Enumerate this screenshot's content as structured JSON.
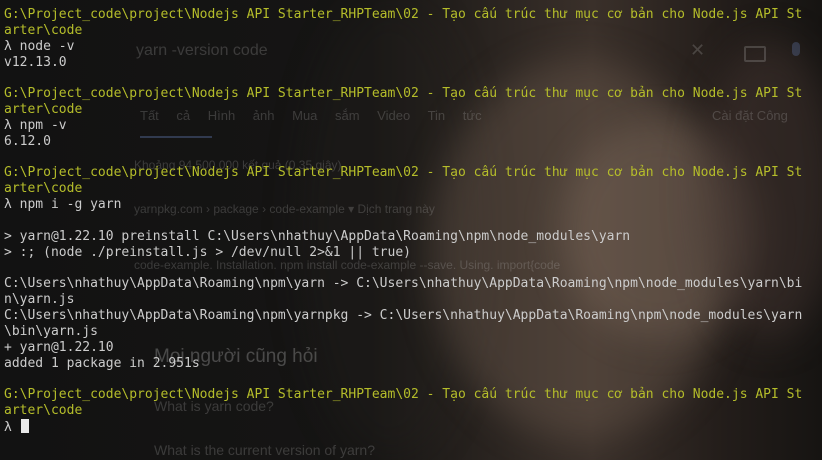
{
  "background_page": {
    "search_query": "yarn -version code",
    "tabs": "Tất cả  Hình ảnh  Mua sắm  Video  Tin tức",
    "tabs_right": "Cài đặt   Công",
    "result_count": "Khoảng 94.500.000 kết quả (0,35 giây)",
    "site_line": "yarnpkg.com › package › code-example ▾ Dịch trang này",
    "snippet": "code-example. Installation. npm install code-example --save. Using. import{code",
    "people_also_ask": "Mọi người cũng hỏi",
    "question_1": "What is yarn code?",
    "question_2": "What is the current version of yarn?"
  },
  "terminal": {
    "lines": [
      {
        "type": "path",
        "text": "G:\\Project_code\\project\\Nodejs API Starter_RHPTeam\\02 - Tạo cấu trúc thư mục cơ bản cho Node.js API St"
      },
      {
        "type": "path",
        "text": "arter\\code"
      },
      {
        "type": "text",
        "text": "λ node -v"
      },
      {
        "type": "text",
        "text": "v12.13.0"
      },
      {
        "type": "text",
        "text": ""
      },
      {
        "type": "path",
        "text": "G:\\Project_code\\project\\Nodejs API Starter_RHPTeam\\02 - Tạo cấu trúc thư mục cơ bản cho Node.js API St"
      },
      {
        "type": "path",
        "text": "arter\\code"
      },
      {
        "type": "text",
        "text": "λ npm -v"
      },
      {
        "type": "text",
        "text": "6.12.0"
      },
      {
        "type": "text",
        "text": ""
      },
      {
        "type": "path",
        "text": "G:\\Project_code\\project\\Nodejs API Starter_RHPTeam\\02 - Tạo cấu trúc thư mục cơ bản cho Node.js API St"
      },
      {
        "type": "path",
        "text": "arter\\code"
      },
      {
        "type": "text",
        "text": "λ npm i -g yarn"
      },
      {
        "type": "text",
        "text": ""
      },
      {
        "type": "text",
        "text": "> yarn@1.22.10 preinstall C:\\Users\\nhathuy\\AppData\\Roaming\\npm\\node_modules\\yarn"
      },
      {
        "type": "text",
        "text": "> :; (node ./preinstall.js > /dev/null 2>&1 || true)"
      },
      {
        "type": "text",
        "text": ""
      },
      {
        "type": "text",
        "text": "C:\\Users\\nhathuy\\AppData\\Roaming\\npm\\yarn -> C:\\Users\\nhathuy\\AppData\\Roaming\\npm\\node_modules\\yarn\\bi"
      },
      {
        "type": "text",
        "text": "n\\yarn.js"
      },
      {
        "type": "text",
        "text": "C:\\Users\\nhathuy\\AppData\\Roaming\\npm\\yarnpkg -> C:\\Users\\nhathuy\\AppData\\Roaming\\npm\\node_modules\\yarn"
      },
      {
        "type": "text",
        "text": "\\bin\\yarn.js"
      },
      {
        "type": "text",
        "text": "+ yarn@1.22.10"
      },
      {
        "type": "text",
        "text": "added 1 package in 2.951s"
      },
      {
        "type": "text",
        "text": ""
      },
      {
        "type": "path",
        "text": "G:\\Project_code\\project\\Nodejs API Starter_RHPTeam\\02 - Tạo cấu trúc thư mục cơ bản cho Node.js API St"
      },
      {
        "type": "path",
        "text": "arter\\code"
      }
    ],
    "prompt": "λ",
    "colors": {
      "path": "#b5bd2a",
      "text": "#cccccc",
      "background": "#0c0c0c"
    }
  }
}
